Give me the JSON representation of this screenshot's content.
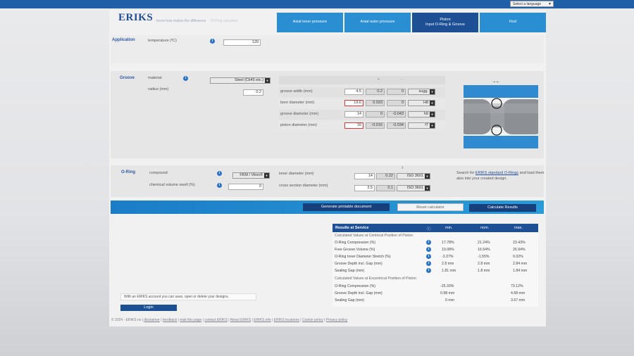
{
  "top": {
    "language_select": "Select a language"
  },
  "brand": {
    "logo": "ERIKS",
    "tagline": "know-how makes the difference",
    "breadcrumb": "O-Ring calculator"
  },
  "tabs": [
    {
      "label": "Axial inner pressure"
    },
    {
      "label": "Axial outer pressure"
    },
    {
      "label": "Piston\nInput O-Ring & Groove"
    },
    {
      "label": "Rod"
    }
  ],
  "application": {
    "section": "Application",
    "temp_label": "temperature (ºC)",
    "temp_value": "120"
  },
  "groove": {
    "section": "Groove",
    "material_label": "material",
    "material_value": "Steel (Ck45 etc.)",
    "radius_label": "radius (mm)",
    "radius_value": "0.2",
    "col_plus": "+",
    "col_minus": "-",
    "rows": [
      {
        "label": "groove width (mm)",
        "nominal": "4.5",
        "plus": "0.2",
        "minus": "0",
        "fit": "sugg."
      },
      {
        "label": "bore diameter (mm)",
        "nominal": "19.6",
        "plus": "0.033",
        "minus": "0",
        "fit": "H8"
      },
      {
        "label": "groove diameter (mm)",
        "nominal": "14",
        "plus": "0",
        "minus": "-0.043",
        "fit": "h9"
      },
      {
        "label": "piston diameter (mm)",
        "nominal": "16",
        "plus": "-0.016",
        "minus": "-0.034",
        "fit": "f7"
      }
    ]
  },
  "oring": {
    "section": "O-Ring",
    "compound_label": "compound",
    "compound_value": "FKM / Viton®",
    "swell_label": "chemical volume swell (%)",
    "swell_value": "0",
    "col_pm": "±",
    "inner_label": "inner diameter (mm)",
    "inner_value": "14",
    "inner_tol": "0.22",
    "inner_std": "ISO 3601",
    "cross_label": "cross section diameter (mm)",
    "cross_value": "3.5",
    "cross_tol": "0.1",
    "cross_std": "ISO 3601",
    "search_text_1": "Search for ",
    "search_link": "ERIKS standard O-Rings",
    "search_text_2": " and load them also into your created design."
  },
  "actions": {
    "print": "Generate printable document",
    "reset": "Reset calculator",
    "calculate": "Calculate Results"
  },
  "results": {
    "title": "Results at Service",
    "col_min": "min.",
    "col_nom": "nom.",
    "col_max": "max.",
    "central_header": "Calculated Values at Centrical Position of Piston:",
    "central": [
      {
        "label": "O-Ring Compression (%)",
        "min": "17.78%",
        "nom": "21.24%",
        "max": "23.43%"
      },
      {
        "label": "Free Groove Volume (%)",
        "min": "10.08%",
        "nom": "16.54%",
        "max": "26.94%"
      },
      {
        "label": "O-Ring Inner Diameter Stretch (%)",
        "min": "-3.37%",
        "nom": "-1.55%",
        "max": "0.02%"
      },
      {
        "label": "Groove Depth incl. Gap (mm)",
        "min": "2.8 mm",
        "nom": "2.8 mm",
        "max": "2.84 mm"
      },
      {
        "label": "Sealing Gap (mm)",
        "min": "1.81 mm",
        "nom": "1.8 mm",
        "max": "1.84 mm"
      }
    ],
    "eccentric_header": "Calculated Values at Excentrical Position of Piston:",
    "eccentric": [
      {
        "label": "O-Ring Compression (%)",
        "min": "-25.33%",
        "nom": "",
        "max": "73.12%"
      },
      {
        "label": "Groove Depth incl. Gap (mm)",
        "min": "0.98 mm",
        "nom": "",
        "max": "4.68 mm"
      },
      {
        "label": "Sealing Gap (mm)",
        "min": "0 mm",
        "nom": "",
        "max": "3.67 mm"
      }
    ]
  },
  "account": {
    "message": "With an ERIKS account you can save, open or delete your designs.",
    "login": "Login"
  },
  "footer": {
    "copyright": "© 2024 - ERIKS nv | ",
    "links": [
      "disclaimer",
      "feedback",
      "mail this page",
      "contact ERIKS",
      "About ERIKS",
      "ERIKS.info",
      "ERIKS locations",
      "Cookie policy",
      "Privacy policy"
    ]
  }
}
